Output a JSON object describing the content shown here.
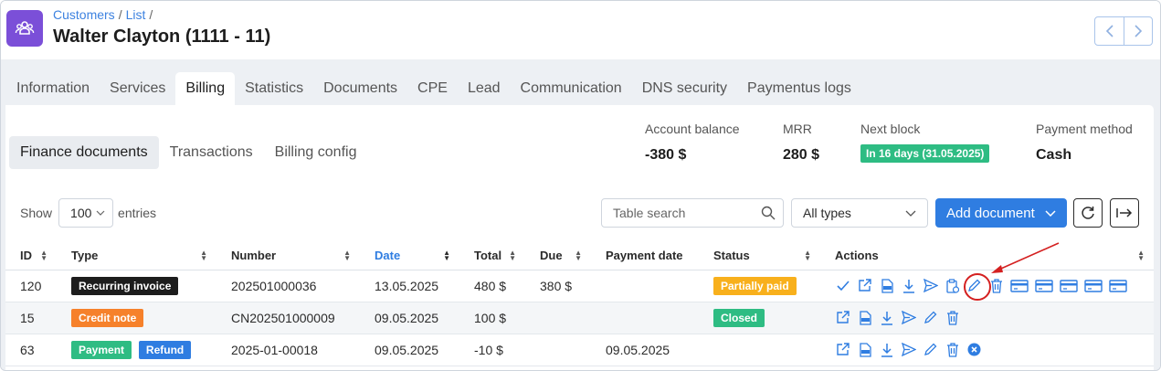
{
  "breadcrumb": {
    "customers": "Customers",
    "list": "List",
    "sep": "/"
  },
  "page_title": "Walter Clayton (1111 - 11)",
  "tabs": [
    "Information",
    "Services",
    "Billing",
    "Statistics",
    "Documents",
    "CPE",
    "Lead",
    "Communication",
    "DNS security",
    "Paymentus logs"
  ],
  "active_tab": "Billing",
  "subtabs": [
    "Finance documents",
    "Transactions",
    "Billing config"
  ],
  "stats": {
    "balance_label": "Account balance",
    "balance_value": "-380 $",
    "mrr_label": "MRR",
    "mrr_value": "280 $",
    "next_block_label": "Next block",
    "next_block_value": "In 16 days (31.05.2025)",
    "payment_label": "Payment method",
    "payment_value": "Cash"
  },
  "controls": {
    "show_label": "Show",
    "entries_value": "100",
    "entries_label": "entries",
    "search_placeholder": "Table search",
    "types_value": "All types",
    "add_document": "Add document"
  },
  "columns": [
    "ID",
    "Type",
    "Number",
    "Date",
    "Total",
    "Due",
    "Payment date",
    "Status",
    "Actions"
  ],
  "rows": [
    {
      "id": "120",
      "type": "Recurring invoice",
      "number": "202501000036",
      "date": "13.05.2025",
      "total": "480 $",
      "due": "380 $",
      "payment_date": "",
      "status": "Partially paid"
    },
    {
      "id": "15",
      "type": "Credit note",
      "number": "CN202501000009",
      "date": "09.05.2025",
      "total": "100 $",
      "due": "",
      "payment_date": "",
      "status": "Closed"
    },
    {
      "id": "63",
      "type": "Payment",
      "type2": "Refund",
      "number": "2025-01-00018",
      "date": "09.05.2025",
      "total": "-10 $",
      "due": "",
      "payment_date": "09.05.2025",
      "status": ""
    }
  ],
  "colors": {
    "accent": "#2f7de1",
    "logo": "#7b4fd8",
    "green": "#2ebc83",
    "orange": "#f6812b",
    "yellow": "#f8b01c",
    "highlight": "#d42020"
  }
}
